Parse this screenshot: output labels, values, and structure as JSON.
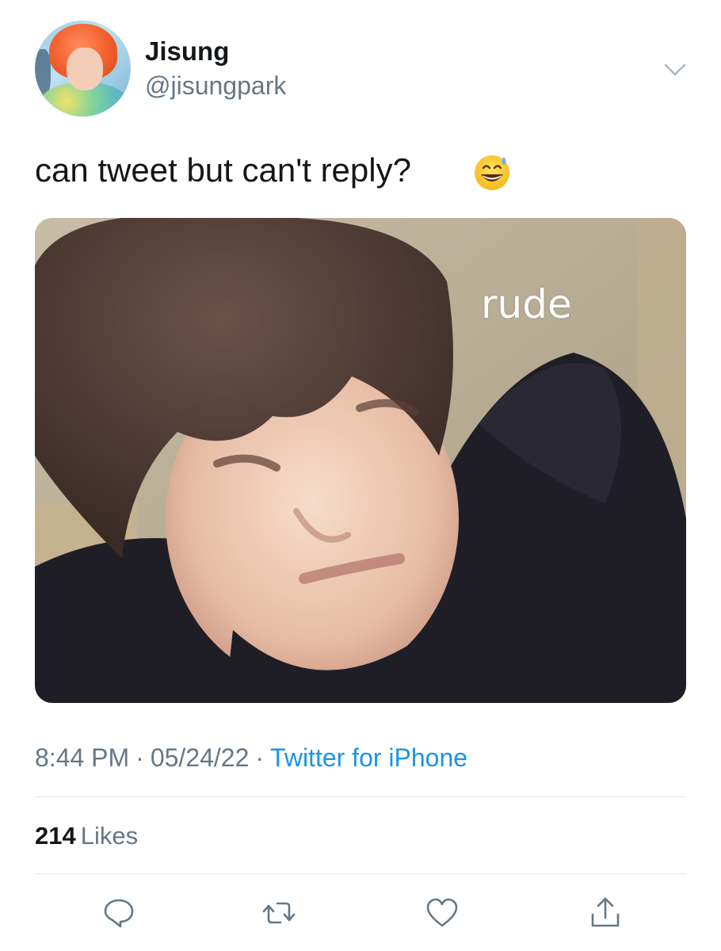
{
  "author": {
    "display_name": "Jisung",
    "handle": "@jisungpark"
  },
  "tweet": {
    "text": "can tweet but can't reply?",
    "emoji_name": "grinning-face-with-sweat-icon"
  },
  "media": {
    "caption": "rude"
  },
  "meta": {
    "time": "8:44 PM",
    "separator": "·",
    "date": "05/24/22",
    "source": "Twitter for iPhone"
  },
  "stats": {
    "likes_count": "214",
    "likes_label": "Likes"
  },
  "actions": [
    {
      "icon": "reply-icon"
    },
    {
      "icon": "retweet-icon"
    },
    {
      "icon": "like-heart-icon"
    },
    {
      "icon": "share-icon"
    }
  ],
  "colors": {
    "text_primary": "#14171a",
    "text_secondary": "#657786",
    "link_blue": "#1b95e0",
    "divider": "#e1e8ed"
  }
}
